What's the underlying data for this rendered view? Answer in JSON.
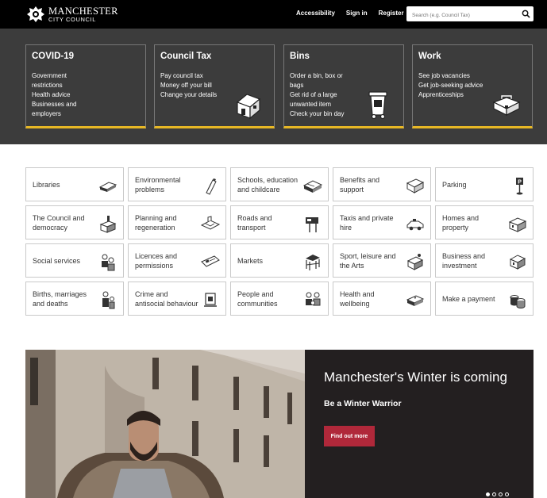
{
  "header": {
    "logo_line1": "MANCHESTER",
    "logo_line2": "CITY COUNCIL",
    "links": [
      "Accessibility",
      "Sign in",
      "Register"
    ],
    "search_placeholder": "Search (e.g. Council Tax)"
  },
  "hero_tiles": [
    {
      "title": "COVID-19",
      "lines": [
        "Government",
        "restrictions",
        "Health advice",
        "Businesses and",
        "employers"
      ],
      "icon": "none"
    },
    {
      "title": "Council Tax",
      "lines": [
        "Pay council tax",
        "Money off your bill",
        "Change your details"
      ],
      "icon": "house-icon"
    },
    {
      "title": "Bins",
      "lines": [
        "Order a bin, box or",
        "bags",
        "Get rid of a large",
        "unwanted item",
        "Check your bin day"
      ],
      "icon": "wheelie-bin-icon"
    },
    {
      "title": "Work",
      "lines": [
        "See job vacancies",
        "Get job-seeking advice",
        "Apprenticeships"
      ],
      "icon": "briefcase-icon"
    }
  ],
  "services": [
    {
      "label": "Libraries",
      "icon": "book-icon"
    },
    {
      "label": "Environmental problems",
      "icon": "spray-can-icon"
    },
    {
      "label": "Schools, education and childcare",
      "icon": "books-icon"
    },
    {
      "label": "Benefits and support",
      "icon": "envelope-icon"
    },
    {
      "label": "Parking",
      "icon": "parking-sign-icon"
    },
    {
      "label": "The Council and democracy",
      "icon": "town-hall-icon"
    },
    {
      "label": "Planning and regeneration",
      "icon": "map-icon"
    },
    {
      "label": "Roads and transport",
      "icon": "road-sign-icon"
    },
    {
      "label": "Taxis and private hire",
      "icon": "taxi-icon"
    },
    {
      "label": "Homes and property",
      "icon": "house-block-icon"
    },
    {
      "label": "Social services",
      "icon": "people-icon"
    },
    {
      "label": "Licences and permissions",
      "icon": "licence-card-icon"
    },
    {
      "label": "Markets",
      "icon": "market-stall-icon"
    },
    {
      "label": "Sport, leisure and the Arts",
      "icon": "theatre-icon"
    },
    {
      "label": "Business and investment",
      "icon": "building-icon"
    },
    {
      "label": "Births, marriages and deaths",
      "icon": "family-icon"
    },
    {
      "label": "Crime and antisocial behaviour",
      "icon": "warning-sign-icon"
    },
    {
      "label": "People and communities",
      "icon": "community-icon"
    },
    {
      "label": "Health and wellbeing",
      "icon": "first-aid-icon"
    },
    {
      "label": "Make a payment",
      "icon": "coins-icon"
    }
  ],
  "promo": {
    "title": "Manchester's Winter is coming",
    "subtitle": "Be a Winter Warrior",
    "button": "Find out more",
    "slides": 4,
    "active_slide": 1
  }
}
